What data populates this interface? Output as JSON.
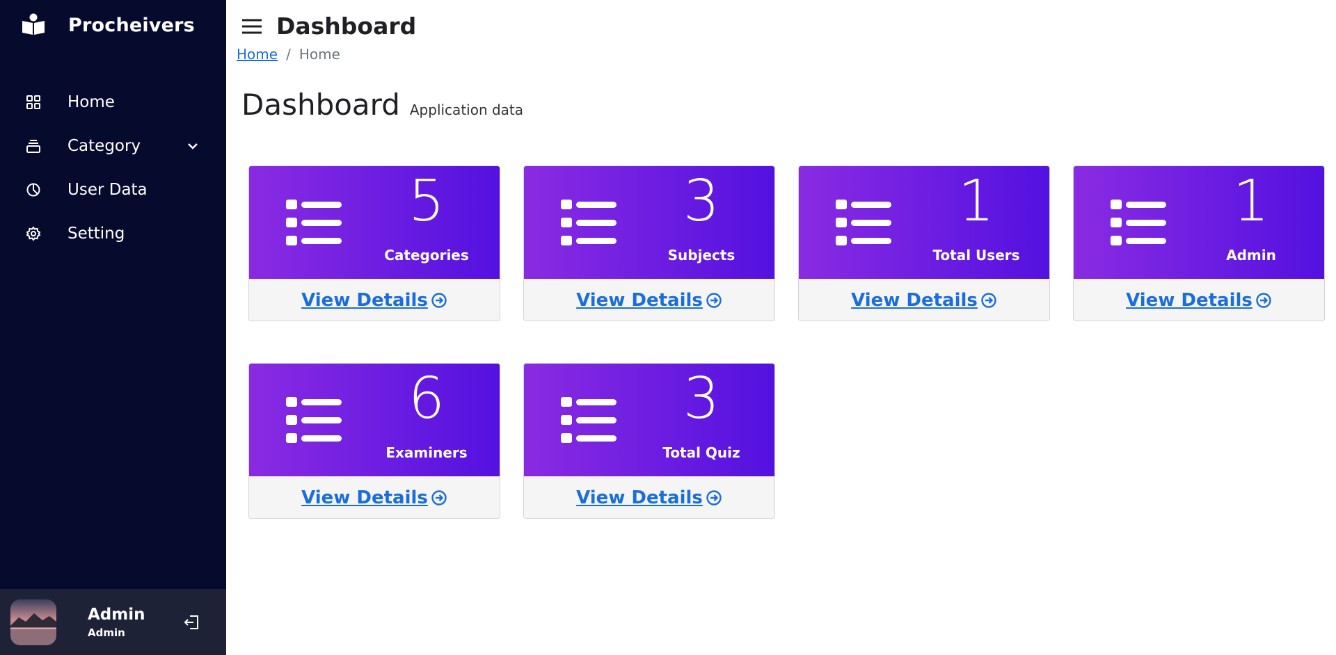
{
  "brand": {
    "name": "Procheivers",
    "icon": "book-reader-icon"
  },
  "sidebar": {
    "items": [
      {
        "label": "Home",
        "icon": "grid-icon"
      },
      {
        "label": "Category",
        "icon": "stack-icon",
        "expandable": true
      },
      {
        "label": "User Data",
        "icon": "pie-chart-icon"
      },
      {
        "label": "Setting",
        "icon": "gear-icon"
      }
    ],
    "user": {
      "name": "Admin",
      "role": "Admin"
    }
  },
  "header": {
    "title": "Dashboard"
  },
  "breadcrumb": {
    "link": "Home",
    "separator": "/",
    "current": "Home"
  },
  "page": {
    "title": "Dashboard",
    "subtitle": "Application data"
  },
  "cards": [
    {
      "value": "5",
      "label": "Categories",
      "link": "View Details"
    },
    {
      "value": "3",
      "label": "Subjects",
      "link": "View Details"
    },
    {
      "value": "1",
      "label": "Total Users",
      "link": "View Details"
    },
    {
      "value": "1",
      "label": "Admin",
      "link": "View Details"
    },
    {
      "value": "6",
      "label": "Examiners",
      "link": "View Details"
    },
    {
      "value": "3",
      "label": "Total Quiz",
      "link": "View Details"
    }
  ],
  "colors": {
    "sidebar": "#060b2e",
    "card_gradient_start": "#8a2be2",
    "card_gradient_end": "#5311e0",
    "link": "#1a6dde"
  }
}
